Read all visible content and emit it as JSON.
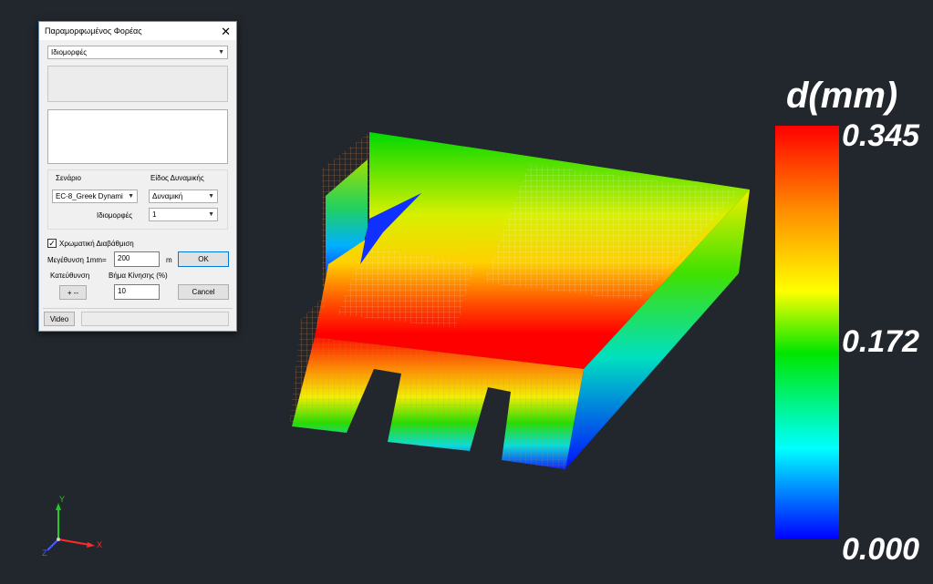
{
  "dialog": {
    "title": "Παραμορφωμένος Φορέας",
    "close_glyph": "✕",
    "mode_select": "Ιδιομορφές",
    "scenario_label": "Σενάριο",
    "scenario_value": "EC-8_Greek Dynami",
    "dynamics_label": "Είδος Δυναμικής",
    "dynamics_value": "Δυναμική",
    "modes_label": "Ιδιομορφές",
    "modes_value": "1",
    "color_check_label": "Χρωματική Διαβάθμιση",
    "color_checked": true,
    "magnification_label": "Μεγέθυνση 1mm=",
    "magnification_value": "200",
    "magnification_unit": "m",
    "ok_label": "OK",
    "direction_label": "Κατεύθυνση",
    "step_label": "Βήμα Κίνησης (%)",
    "direction_button": "+ --",
    "step_value": "10",
    "cancel_label": "Cancel",
    "video_label": "Video"
  },
  "legend": {
    "title": "d(mm)",
    "max_label": "0.345",
    "mid_label": "0.172",
    "min_label": "0.000",
    "colors": [
      "#ff0000",
      "#ff8a00",
      "#ffff00",
      "#00e600",
      "#00ffff",
      "#0000ff"
    ]
  },
  "axes": {
    "x_label": "X",
    "y_label": "Y",
    "z_label": "Z",
    "x_color": "#ff2a2a",
    "y_color": "#22cc22",
    "z_color": "#4a5cff"
  },
  "colors": {
    "background": "#22272d",
    "wire": "#e8e8e8",
    "wire_orange": "#c9864a"
  }
}
